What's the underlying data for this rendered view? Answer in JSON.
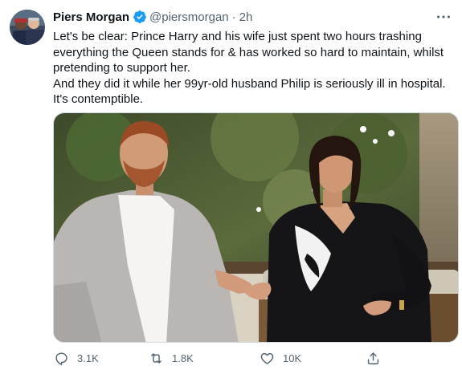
{
  "author": {
    "name": "Piers Morgan",
    "handle": "@piersmorgan",
    "separator": "·",
    "time": "2h",
    "verified": true
  },
  "tweet": {
    "paragraphs": [
      "Let's be clear: Prince Harry and his wife just spent two hours trashing everything the Queen stands for & has worked so hard to maintain, whilst pretending to support her.",
      "And they did it while her 99yr-old husband Philip is seriously ill in hospital. It's contemptible."
    ]
  },
  "media": {
    "type": "photo"
  },
  "actions": {
    "replies": "3.1K",
    "retweets": "1.8K",
    "likes": "10K"
  },
  "icons": {
    "verified": "verified-badge-icon",
    "more": "more-options-icon",
    "reply": "reply-icon",
    "retweet": "retweet-icon",
    "like": "heart-icon",
    "share": "share-icon"
  },
  "colors": {
    "text": "#0f1419",
    "secondary": "#536471",
    "verified": "#1d9bf0"
  }
}
